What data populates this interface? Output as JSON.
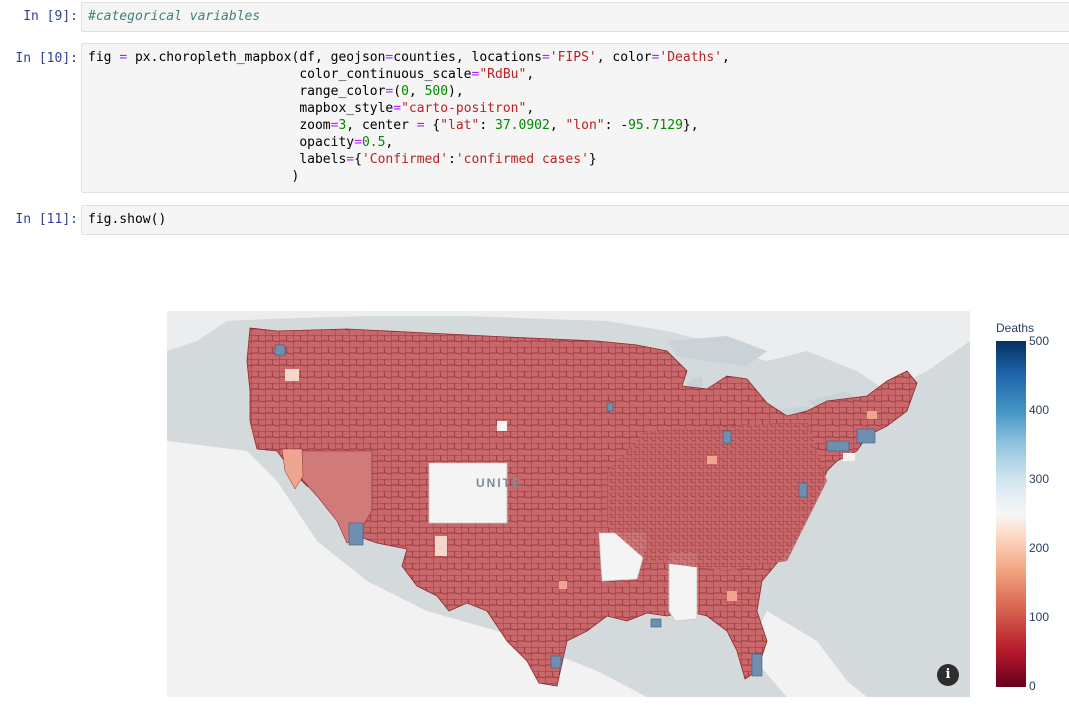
{
  "cells": [
    {
      "prompt": "In [9]:",
      "code": "#categorical variables"
    },
    {
      "prompt": "In [10]:",
      "code_lines": [
        "fig = px.choropleth_mapbox(df, geojson=counties, locations='FIPS', color='Deaths',",
        "                           color_continuous_scale=\"RdBu\",",
        "                           range_color=(0, 500),",
        "                           mapbox_style=\"carto-positron\",",
        "                           zoom=3, center = {\"lat\": 37.0902, \"lon\": -95.7129},",
        "                           opacity=0.5,",
        "                           labels={'Confirmed':'confirmed cases'}",
        "                          )"
      ]
    },
    {
      "prompt": "In [11]:",
      "code": "fig.show()"
    }
  ],
  "map": {
    "country_label": "UNITE",
    "info_icon": "info-icon",
    "colors": {
      "land": "#f2f2f2",
      "water": "#d4dadc",
      "county_fill": "#c8686b",
      "county_stroke": "#8a2a30",
      "high_deaths": "#6f8fb0",
      "mid": "#f0a592",
      "no_data": "#f7f7f7"
    }
  },
  "colorbar": {
    "title": "Deaths",
    "ticks": [
      "500",
      "400",
      "300",
      "200",
      "100",
      "0"
    ],
    "range": [
      0,
      500
    ],
    "scale": "RdBu"
  }
}
